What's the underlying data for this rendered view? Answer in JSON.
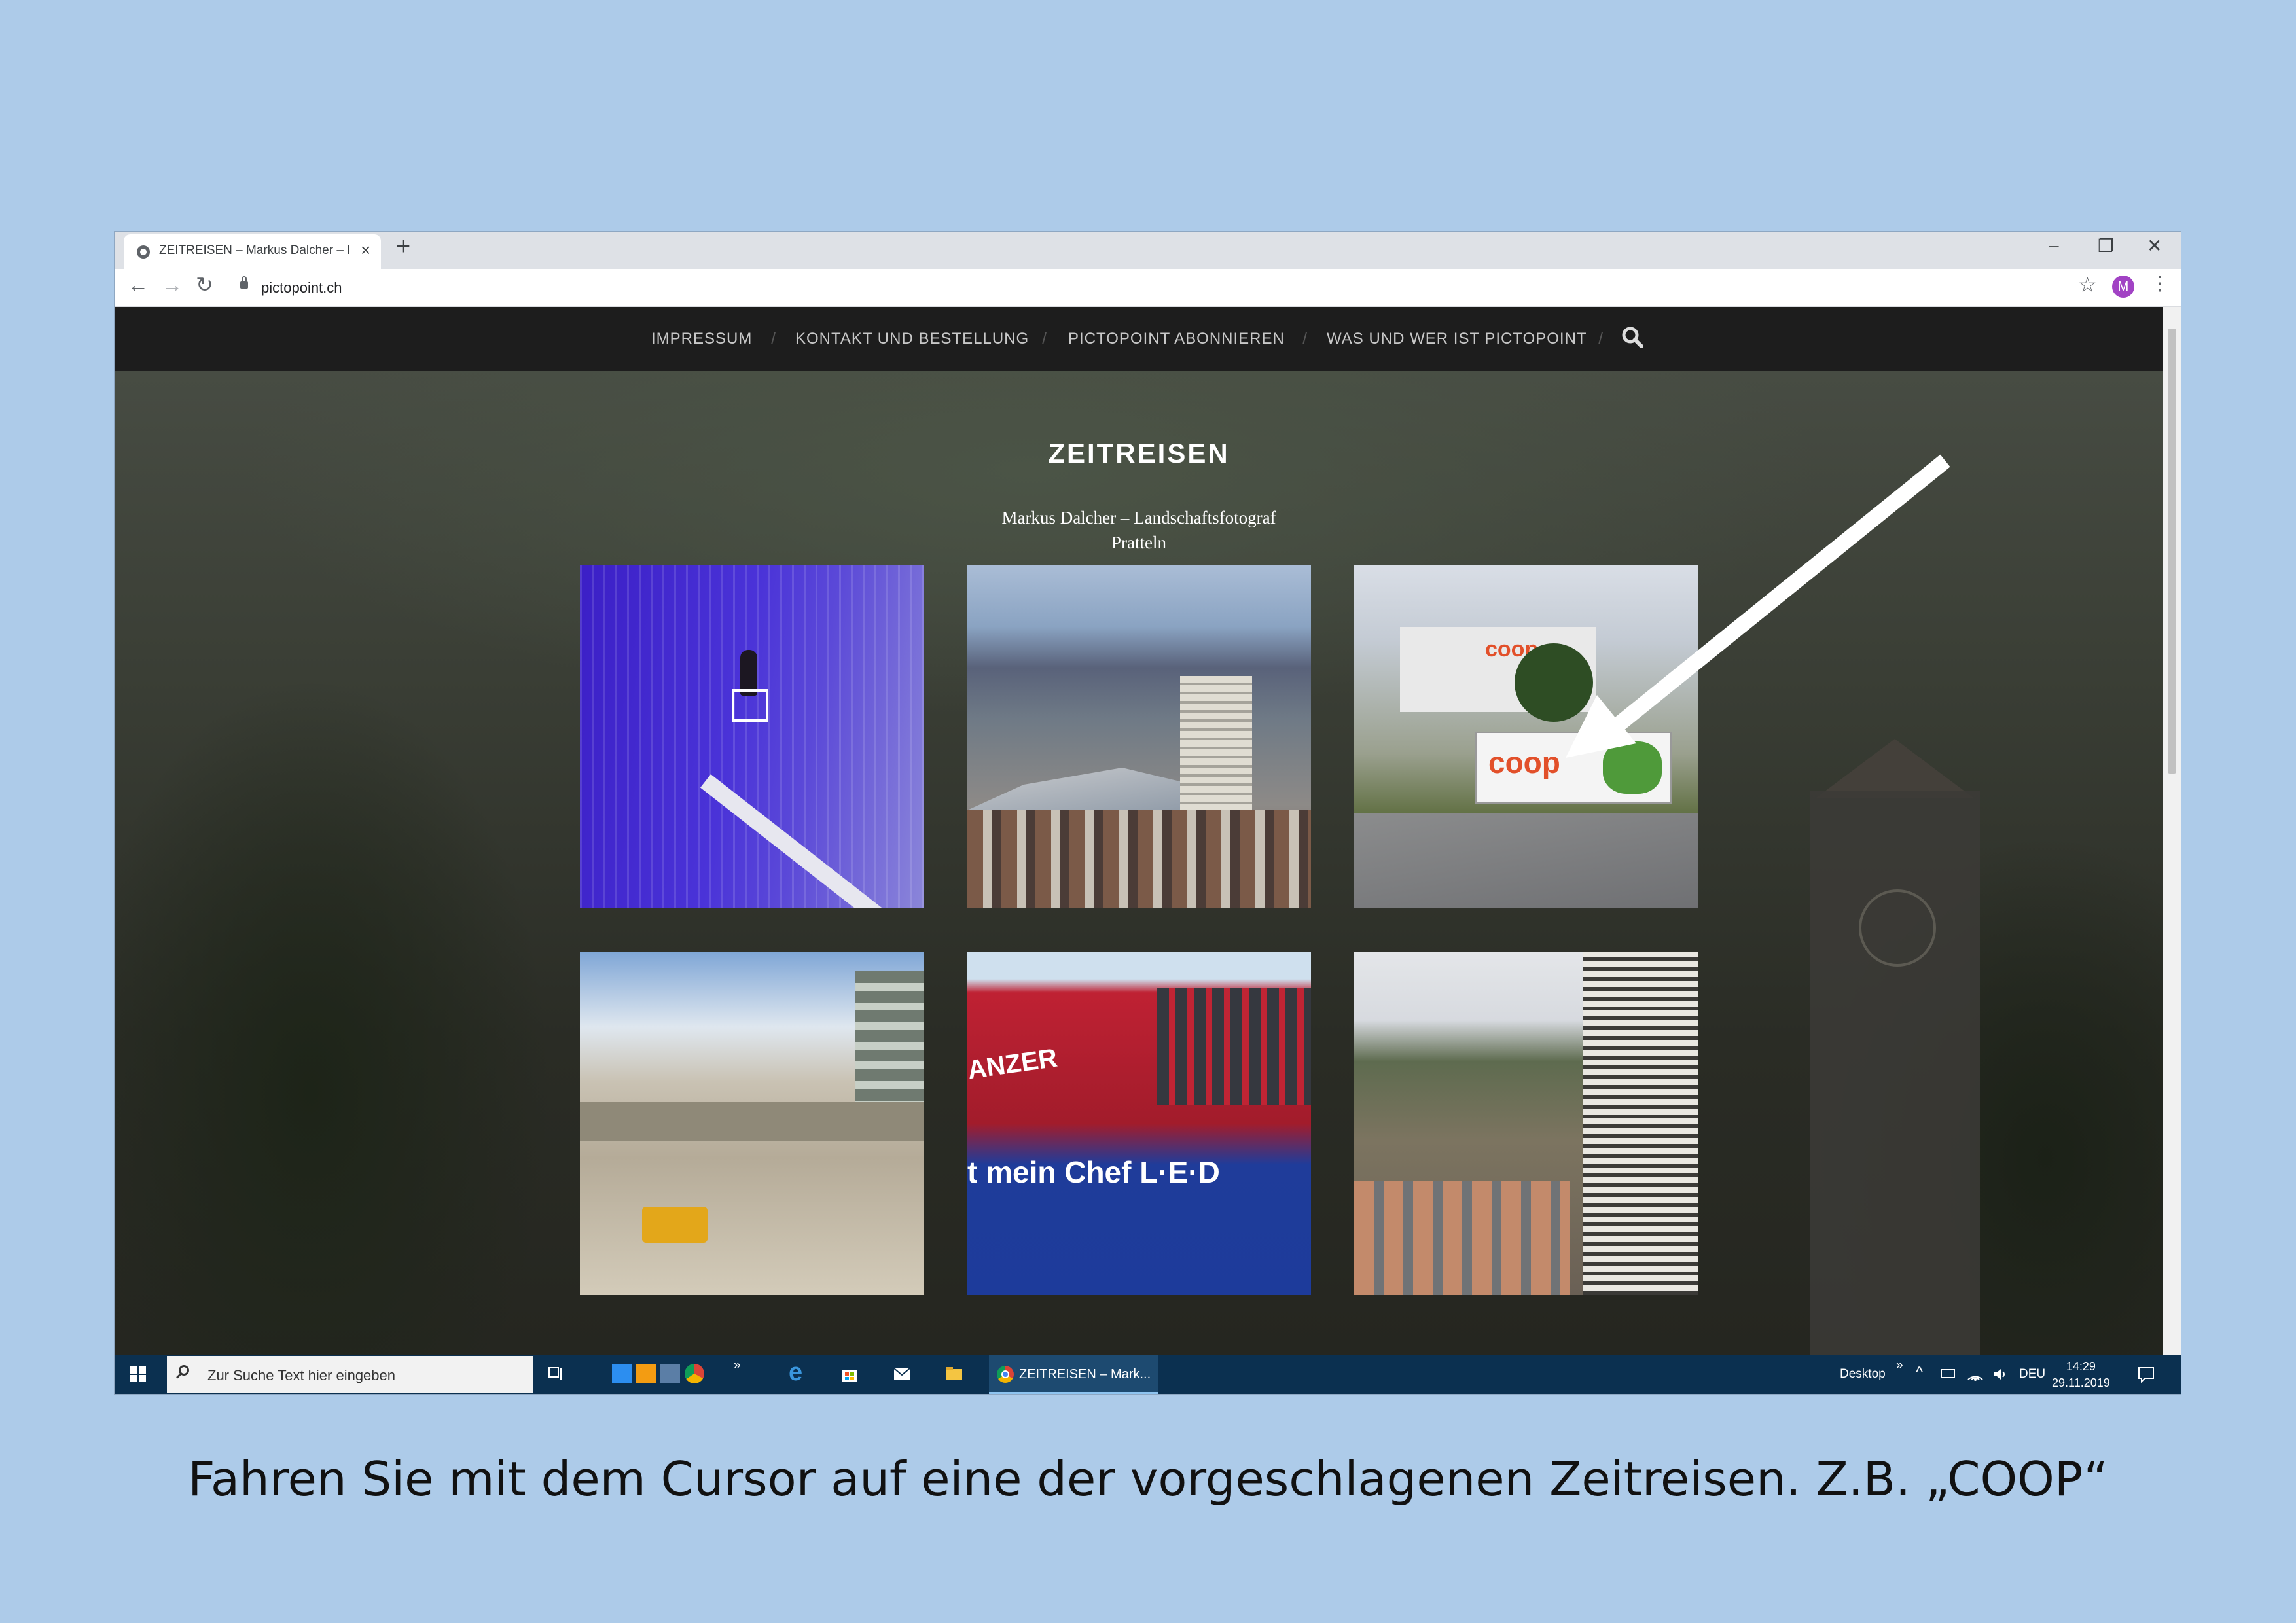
{
  "browser": {
    "tab_title": "ZEITREISEN – Markus Dalcher – L",
    "new_tab": "+",
    "tab_close": "×",
    "url": "pictopoint.ch",
    "profile_initial": "M",
    "window_controls": {
      "minimize": "–",
      "restore": "❐",
      "close": "✕"
    },
    "nav": {
      "back": "←",
      "forward": "→",
      "reload": "↻",
      "star": "☆",
      "menu": "⋮"
    }
  },
  "site": {
    "nav": [
      {
        "label": "IMPRESSUM"
      },
      {
        "label": "KONTAKT UND BESTELLUNG"
      },
      {
        "label": "PICTOPOINT ABONNIEREN"
      },
      {
        "label": "WAS UND WER IST PICTOPOINT"
      }
    ],
    "nav_separator": "/",
    "title": "ZEITREISEN",
    "description_line1": "Markus Dalcher – Landschaftsfotograf",
    "description_line2": "Pratteln",
    "thumbnails": [
      {
        "subject": "facade painter on lift"
      },
      {
        "subject": "town view with tower"
      },
      {
        "subject": "Coop distribution center",
        "sign1": "coop",
        "sign2": "coop"
      },
      {
        "subject": "construction pit with excavator"
      },
      {
        "subject": "red building with truck",
        "sign": "ANZER",
        "truck_text": "t mein Chef L·E·D"
      },
      {
        "subject": "residential high-rise"
      }
    ]
  },
  "taskbar": {
    "search_placeholder": "Zur Suche Text hier eingeben",
    "active_window": "ZEITREISEN – Mark...",
    "desktop_label": "Desktop",
    "chevrons": "»",
    "language": "DEU",
    "time": "14:29",
    "date": "29.11.2019"
  },
  "caption": "Fahren Sie mit dem Cursor auf eine der vorgeschlagenen Zeitreisen. Z.B. „COOP“",
  "colors": {
    "page_background": "#adcbe9",
    "navbar": "#1d1d1d",
    "taskbar": "#0b3050",
    "profile": "#a142c4",
    "coop_orange": "#e2502a"
  }
}
